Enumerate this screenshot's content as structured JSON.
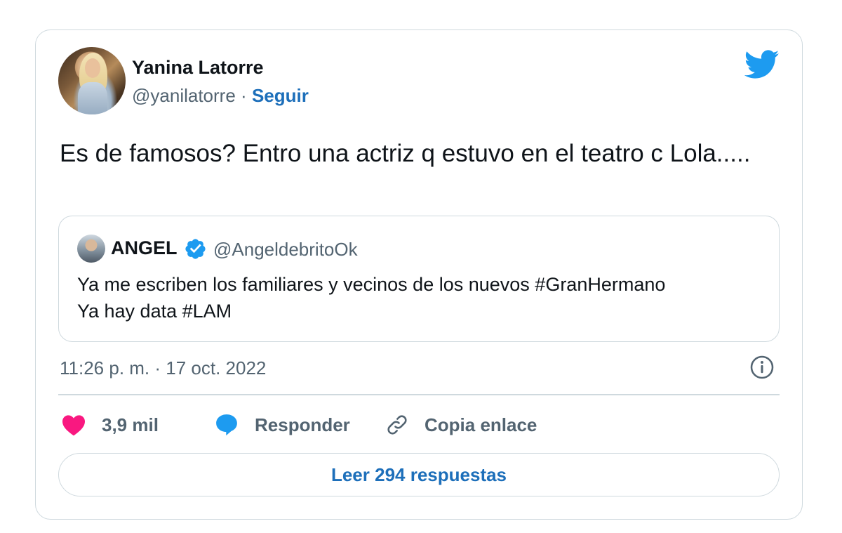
{
  "author": {
    "name": "Yanina Latorre",
    "handle": "@yanilatorre",
    "separator": "·",
    "follow_label": "Seguir"
  },
  "tweet": {
    "text": "Es de famosos? Entro una actriz q estuvo en el teatro c Lola.....",
    "timestamp": "11:26 p. m. · 17 oct. 2022"
  },
  "quoted_tweet": {
    "name": "ANGEL",
    "handle": "@AngeldebritoOk",
    "line1": "Ya me escriben los familiares y vecinos de los nuevos #GranHermano",
    "line2": "Ya hay data #LAM"
  },
  "actions": {
    "likes": "3,9 mil",
    "reply_label": "Responder",
    "copy_link_label": "Copia enlace"
  },
  "read_replies_label": "Leer 294 respuestas",
  "icons": {
    "logo": "twitter-bird-icon",
    "verified": "verified-badge-icon",
    "info": "info-icon",
    "like": "heart-icon",
    "reply": "speech-bubble-icon",
    "link": "link-icon"
  },
  "colors": {
    "brand_blue": "#1d9bf0",
    "link_blue": "#1d6fba",
    "like_pink": "#f91880",
    "secondary_text": "#536471",
    "border": "#cfd9de"
  }
}
